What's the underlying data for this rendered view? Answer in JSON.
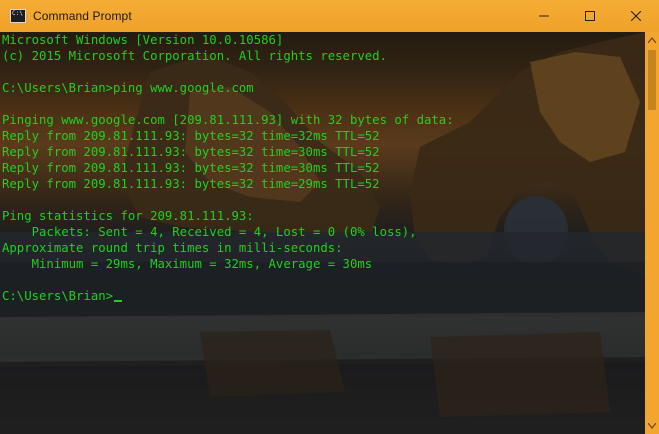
{
  "window": {
    "title": "Command Prompt",
    "icon": "cmd-icon",
    "icon_text": "C:\\"
  },
  "controls": {
    "minimize_icon": "minimize-icon",
    "maximize_icon": "maximize-icon",
    "close_icon": "close-icon"
  },
  "terminal": {
    "lines": [
      "Microsoft Windows [Version 10.0.10586]",
      "(c) 2015 Microsoft Corporation. All rights reserved.",
      "",
      "C:\\Users\\Brian>ping www.google.com",
      "",
      "Pinging www.google.com [209.81.111.93] with 32 bytes of data:",
      "Reply from 209.81.111.93: bytes=32 time=32ms TTL=52",
      "Reply from 209.81.111.93: bytes=32 time=30ms TTL=52",
      "Reply from 209.81.111.93: bytes=32 time=30ms TTL=52",
      "Reply from 209.81.111.93: bytes=32 time=29ms TTL=52",
      "",
      "Ping statistics for 209.81.111.93:",
      "    Packets: Sent = 4, Received = 4, Lost = 0 (0% loss),",
      "Approximate round trip times in milli-seconds:",
      "    Minimum = 29ms, Maximum = 32ms, Average = 30ms",
      "",
      "C:\\Users\\Brian>"
    ],
    "text_color": "#20d020"
  },
  "colors": {
    "titlebar": "#f3a72e",
    "scrollbar": "#f2a52f"
  }
}
